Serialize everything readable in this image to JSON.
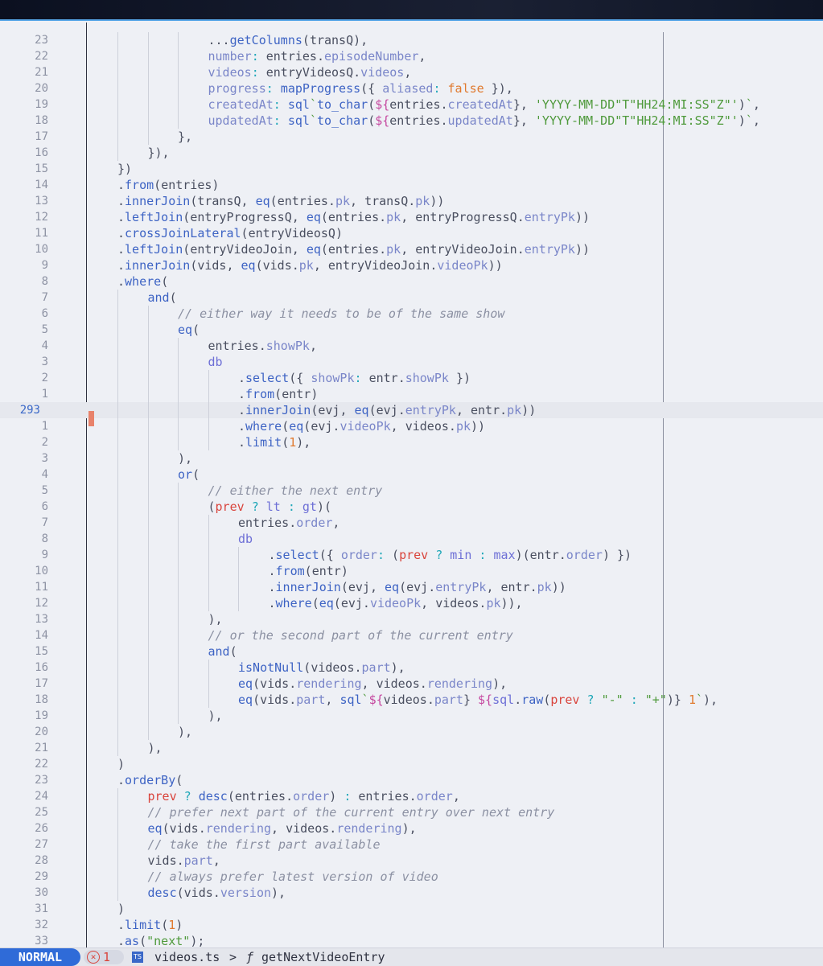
{
  "editor": {
    "cursor_line": "293",
    "lines": [
      {
        "n": "23",
        "i": 0,
        "t": [
          [
            "",
            "        "
          ],
          [
            "op",
            "..."
          ],
          [
            "fn",
            "getColumns"
          ],
          [
            "pn",
            "(transQ),"
          ]
        ],
        "raw": "            ...getColumns(transQ),"
      },
      {
        "n": "22",
        "raw": "            number: entries.episodeNumber,"
      },
      {
        "n": "21",
        "raw": "            videos: entryVideosQ.videos,"
      },
      {
        "n": "20",
        "raw": "            progress: mapProgress({ aliased: false }),"
      },
      {
        "n": "19",
        "raw": "            createdAt: sql`to_char(${entries.createdAt}, 'YYYY-MM-DD\"T\"HH24:MI:SS\"Z\"')`,"
      },
      {
        "n": "18",
        "raw": "            updatedAt: sql`to_char(${entries.updatedAt}, 'YYYY-MM-DD\"T\"HH24:MI:SS\"Z\"')`,"
      },
      {
        "n": "17",
        "raw": "        },"
      },
      {
        "n": "16",
        "raw": "    }),"
      },
      {
        "n": "15",
        "raw": "})"
      },
      {
        "n": "14",
        "raw": ".from(entries)"
      },
      {
        "n": "13",
        "raw": ".innerJoin(transQ, eq(entries.pk, transQ.pk))"
      },
      {
        "n": "12",
        "raw": ".leftJoin(entryProgressQ, eq(entries.pk, entryProgressQ.entryPk))"
      },
      {
        "n": "11",
        "raw": ".crossJoinLateral(entryVideosQ)"
      },
      {
        "n": "10",
        "raw": ".leftJoin(entryVideoJoin, eq(entries.pk, entryVideoJoin.entryPk))"
      },
      {
        "n": "9",
        "raw": ".innerJoin(vids, eq(vids.pk, entryVideoJoin.videoPk))"
      },
      {
        "n": "8",
        "raw": ".where("
      },
      {
        "n": "7",
        "raw": "    and("
      },
      {
        "n": "6",
        "raw": "        // either way it needs to be of the same show"
      },
      {
        "n": "5",
        "raw": "        eq("
      },
      {
        "n": "4",
        "raw": "            entries.showPk,"
      },
      {
        "n": "3",
        "raw": "            db"
      },
      {
        "n": "2",
        "raw": "                .select({ showPk: entr.showPk })"
      },
      {
        "n": "1",
        "raw": "                .from(entr)"
      },
      {
        "n": "293",
        "raw": "                .innerJoin(evj, eq(evj.entryPk, entr.pk))"
      },
      {
        "n": "1",
        "raw": "                .where(eq(evj.videoPk, videos.pk))"
      },
      {
        "n": "2",
        "raw": "                .limit(1),"
      },
      {
        "n": "3",
        "raw": "        ),"
      },
      {
        "n": "4",
        "raw": "        or("
      },
      {
        "n": "5",
        "raw": "            // either the next entry"
      },
      {
        "n": "6",
        "raw": "            (prev ? lt : gt)("
      },
      {
        "n": "7",
        "raw": "                entries.order,"
      },
      {
        "n": "8",
        "raw": "                db"
      },
      {
        "n": "9",
        "raw": "                    .select({ order: (prev ? min : max)(entr.order) })"
      },
      {
        "n": "10",
        "raw": "                    .from(entr)"
      },
      {
        "n": "11",
        "raw": "                    .innerJoin(evj, eq(evj.entryPk, entr.pk))"
      },
      {
        "n": "12",
        "raw": "                    .where(eq(evj.videoPk, videos.pk)),"
      },
      {
        "n": "13",
        "raw": "            ),"
      },
      {
        "n": "14",
        "raw": "            // or the second part of the current entry"
      },
      {
        "n": "15",
        "raw": "            and("
      },
      {
        "n": "16",
        "raw": "                isNotNull(videos.part),"
      },
      {
        "n": "17",
        "raw": "                eq(vids.rendering, videos.rendering),"
      },
      {
        "n": "18",
        "raw": "                eq(vids.part, sql`${videos.part} ${sql.raw(prev ? \"-\" : \"+\")} 1`),"
      },
      {
        "n": "19",
        "raw": "            ),"
      },
      {
        "n": "20",
        "raw": "        ),"
      },
      {
        "n": "21",
        "raw": "    ),"
      },
      {
        "n": "22",
        "raw": ")"
      },
      {
        "n": "23",
        "raw": ".orderBy("
      },
      {
        "n": "24",
        "raw": "    prev ? desc(entries.order) : entries.order,"
      },
      {
        "n": "25",
        "raw": "    // prefer next part of the current entry over next entry"
      },
      {
        "n": "26",
        "raw": "    eq(vids.rendering, videos.rendering),"
      },
      {
        "n": "27",
        "raw": "    // take the first part available"
      },
      {
        "n": "28",
        "raw": "    vids.part,"
      },
      {
        "n": "29",
        "raw": "    // always prefer latest version of video"
      },
      {
        "n": "30",
        "raw": "    desc(vids.version),"
      },
      {
        "n": "31",
        "raw": ")"
      },
      {
        "n": "32",
        "raw": ".limit(1)"
      },
      {
        "n": "33",
        "raw": ".as(\"next\");"
      }
    ]
  },
  "statusbar": {
    "mode": "NORMAL",
    "error_count": "1",
    "filetype_icon_label": "TS",
    "filename": "videos.ts",
    "separator": ">",
    "function_icon": "ƒ",
    "function_name": "getNextVideoEntry"
  },
  "colors": {
    "mode_bg": "#2f6bd8",
    "git_change": "#e8826b",
    "error": "#d9443c"
  }
}
